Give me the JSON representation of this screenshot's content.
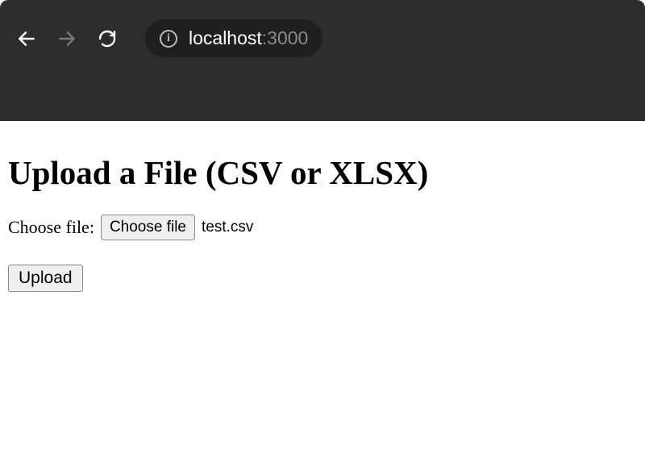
{
  "browser": {
    "url_host": "localhost",
    "url_port": ":3000"
  },
  "page": {
    "heading": "Upload a File (CSV or XLSX)",
    "choose_label": "Choose file:",
    "choose_button": "Choose file",
    "selected_filename": "test.csv",
    "upload_button": "Upload"
  }
}
